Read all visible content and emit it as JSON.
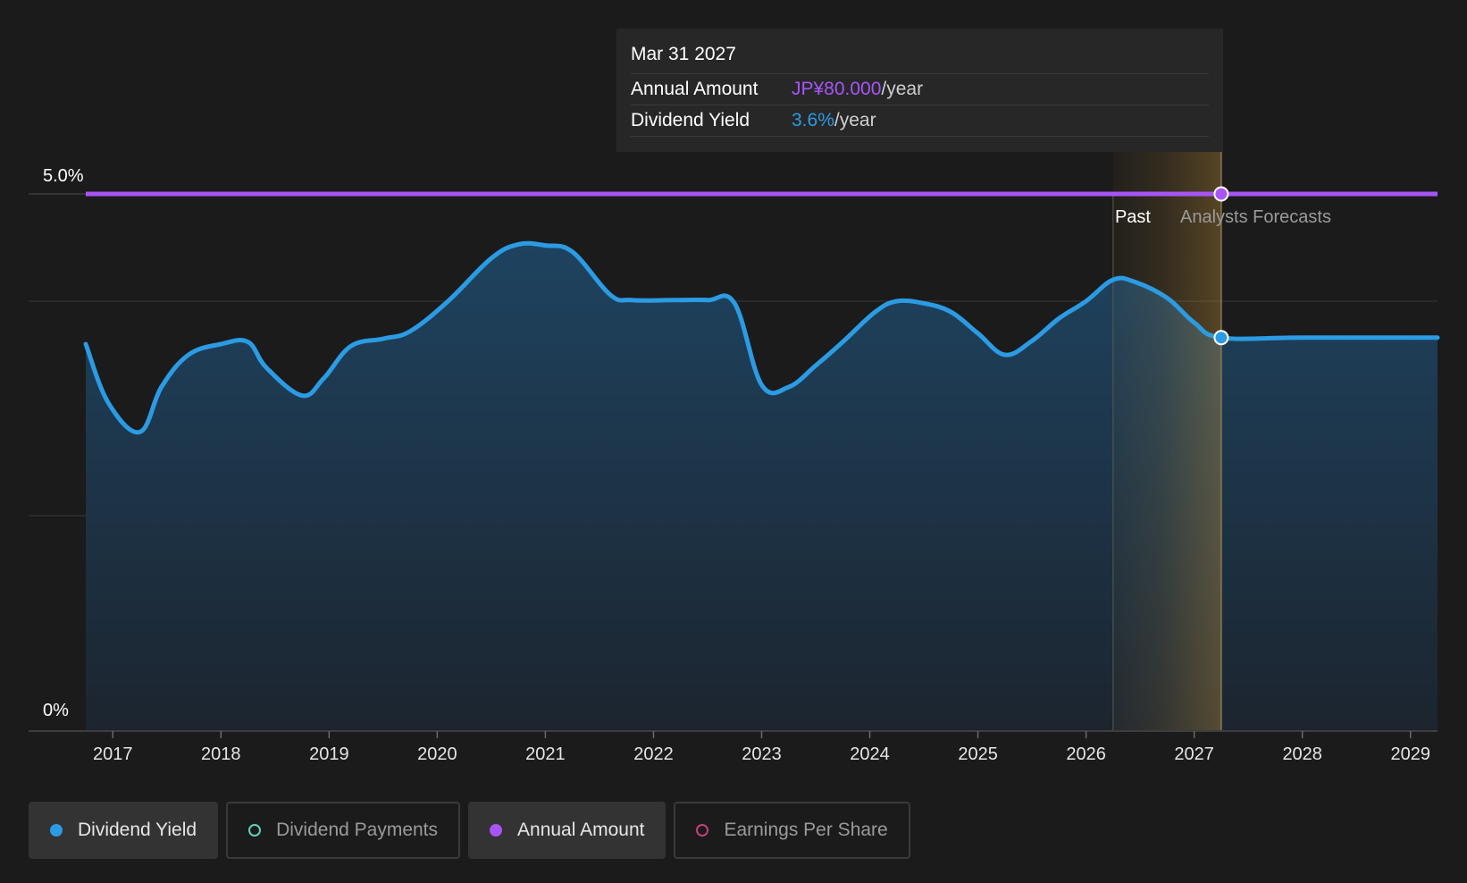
{
  "tooltip": {
    "date": "Mar 31 2027",
    "rows": [
      {
        "label": "Annual Amount",
        "value": "JP¥80.000",
        "unit": "/year"
      },
      {
        "label": "Dividend Yield",
        "value": "3.6%",
        "unit": "/year"
      }
    ]
  },
  "regions": {
    "past_label": "Past",
    "forecast_label": "Analysts Forecasts"
  },
  "legend": [
    {
      "label": "Dividend Yield",
      "color": "#2b9be3",
      "active": true
    },
    {
      "label": "Dividend Payments",
      "color": "#5fd0b6",
      "active": false
    },
    {
      "label": "Annual Amount",
      "color": "#a855f7",
      "active": true
    },
    {
      "label": "Earnings Per Share",
      "color": "#c2407a",
      "active": false
    }
  ],
  "colors": {
    "dividend_yield": "#2b9be3",
    "annual_amount": "#a855f7",
    "forecast_band": "#e0a53a",
    "background": "#1b1b1b"
  },
  "chart_data": {
    "type": "area",
    "y_tick_labels": [
      "0%",
      "5.0%"
    ],
    "ylim": [
      0,
      5.0
    ],
    "x_tick_labels": [
      "2017",
      "2018",
      "2019",
      "2020",
      "2021",
      "2022",
      "2023",
      "2024",
      "2025",
      "2026",
      "2027",
      "2028",
      "2029"
    ],
    "xlim": [
      2016.75,
      2029.25
    ],
    "forecast_start": 2026.25,
    "forecast_end": 2027.25,
    "grid": true,
    "series": [
      {
        "name": "Dividend Yield",
        "unit": "%",
        "x": [
          2016.75,
          2016.96,
          2017.25,
          2017.45,
          2017.7,
          2018.0,
          2018.25,
          2018.42,
          2018.75,
          2018.95,
          2019.2,
          2019.5,
          2019.75,
          2020.1,
          2020.5,
          2020.75,
          2021.0,
          2021.25,
          2021.6,
          2021.8,
          2022.2,
          2022.5,
          2022.75,
          2023.0,
          2023.25,
          2023.5,
          2023.75,
          2024.05,
          2024.25,
          2024.5,
          2024.75,
          2025.0,
          2025.25,
          2025.5,
          2025.75,
          2026.0,
          2026.25,
          2026.45,
          2026.75,
          2027.0,
          2027.25,
          2028.0,
          2029.25
        ],
        "values": [
          3.6,
          3.05,
          2.78,
          3.2,
          3.5,
          3.6,
          3.62,
          3.38,
          3.12,
          3.28,
          3.58,
          3.65,
          3.72,
          4.0,
          4.4,
          4.53,
          4.52,
          4.46,
          4.06,
          4.01,
          4.01,
          4.01,
          3.98,
          3.22,
          3.2,
          3.4,
          3.62,
          3.9,
          4.0,
          3.98,
          3.9,
          3.7,
          3.5,
          3.63,
          3.84,
          4.0,
          4.2,
          4.18,
          4.03,
          3.8,
          3.66,
          3.66,
          3.66
        ]
      },
      {
        "name": "Annual Amount",
        "x": [
          2016.75,
          2029.25
        ],
        "values": [
          5.0,
          5.0
        ]
      }
    ],
    "highlight_point": {
      "date": "Mar 31 2027",
      "x": 2027.25,
      "dividend_yield": 3.6,
      "annual_amount": "JP¥80.000"
    }
  }
}
